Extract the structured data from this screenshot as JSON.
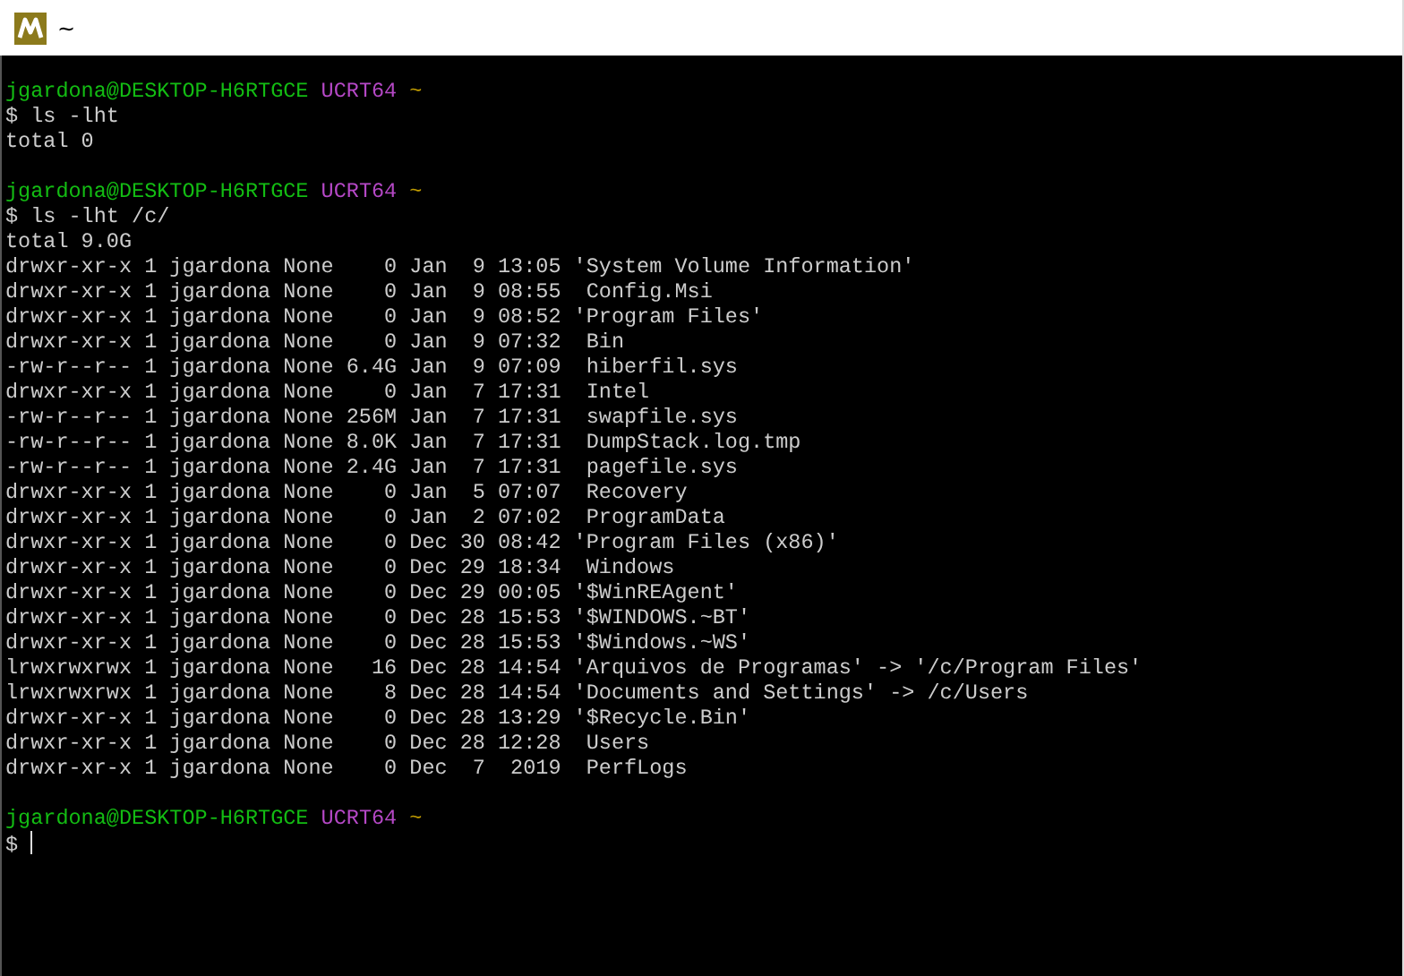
{
  "window": {
    "title": "~"
  },
  "terminal": {
    "lines": [
      {
        "kind": "prompt",
        "user_host": "jgardona@DESKTOP-H6RTGCE",
        "env": "UCRT64",
        "cwd": "~"
      },
      {
        "kind": "command",
        "prompt": "$",
        "text": "ls -lht"
      },
      {
        "kind": "output",
        "text": "total 0"
      },
      {
        "kind": "blank"
      },
      {
        "kind": "prompt",
        "user_host": "jgardona@DESKTOP-H6RTGCE",
        "env": "UCRT64",
        "cwd": "~"
      },
      {
        "kind": "command",
        "prompt": "$",
        "text": "ls -lht /c/"
      },
      {
        "kind": "output",
        "text": "total 9.0G"
      },
      {
        "kind": "output",
        "text": "drwxr-xr-x 1 jgardona None    0 Jan  9 13:05 'System Volume Information'"
      },
      {
        "kind": "output",
        "text": "drwxr-xr-x 1 jgardona None    0 Jan  9 08:55  Config.Msi"
      },
      {
        "kind": "output",
        "text": "drwxr-xr-x 1 jgardona None    0 Jan  9 08:52 'Program Files'"
      },
      {
        "kind": "output",
        "text": "drwxr-xr-x 1 jgardona None    0 Jan  9 07:32  Bin"
      },
      {
        "kind": "output",
        "text": "-rw-r--r-- 1 jgardona None 6.4G Jan  9 07:09  hiberfil.sys"
      },
      {
        "kind": "output",
        "text": "drwxr-xr-x 1 jgardona None    0 Jan  7 17:31  Intel"
      },
      {
        "kind": "output",
        "text": "-rw-r--r-- 1 jgardona None 256M Jan  7 17:31  swapfile.sys"
      },
      {
        "kind": "output",
        "text": "-rw-r--r-- 1 jgardona None 8.0K Jan  7 17:31  DumpStack.log.tmp"
      },
      {
        "kind": "output",
        "text": "-rw-r--r-- 1 jgardona None 2.4G Jan  7 17:31  pagefile.sys"
      },
      {
        "kind": "output",
        "text": "drwxr-xr-x 1 jgardona None    0 Jan  5 07:07  Recovery"
      },
      {
        "kind": "output",
        "text": "drwxr-xr-x 1 jgardona None    0 Jan  2 07:02  ProgramData"
      },
      {
        "kind": "output",
        "text": "drwxr-xr-x 1 jgardona None    0 Dec 30 08:42 'Program Files (x86)'"
      },
      {
        "kind": "output",
        "text": "drwxr-xr-x 1 jgardona None    0 Dec 29 18:34  Windows"
      },
      {
        "kind": "output",
        "text": "drwxr-xr-x 1 jgardona None    0 Dec 29 00:05 '$WinREAgent'"
      },
      {
        "kind": "output",
        "text": "drwxr-xr-x 1 jgardona None    0 Dec 28 15:53 '$WINDOWS.~BT'"
      },
      {
        "kind": "output",
        "text": "drwxr-xr-x 1 jgardona None    0 Dec 28 15:53 '$Windows.~WS'"
      },
      {
        "kind": "output",
        "text": "lrwxrwxrwx 1 jgardona None   16 Dec 28 14:54 'Arquivos de Programas' -> '/c/Program Files'"
      },
      {
        "kind": "output",
        "text": "lrwxrwxrwx 1 jgardona None    8 Dec 28 14:54 'Documents and Settings' -> /c/Users"
      },
      {
        "kind": "output",
        "text": "drwxr-xr-x 1 jgardona None    0 Dec 28 13:29 '$Recycle.Bin'"
      },
      {
        "kind": "output",
        "text": "drwxr-xr-x 1 jgardona None    0 Dec 28 12:28  Users"
      },
      {
        "kind": "output",
        "text": "drwxr-xr-x 1 jgardona None    0 Dec  7  2019  PerfLogs"
      },
      {
        "kind": "blank"
      },
      {
        "kind": "prompt",
        "user_host": "jgardona@DESKTOP-H6RTGCE",
        "env": "UCRT64",
        "cwd": "~"
      },
      {
        "kind": "input",
        "prompt": "$"
      }
    ]
  }
}
